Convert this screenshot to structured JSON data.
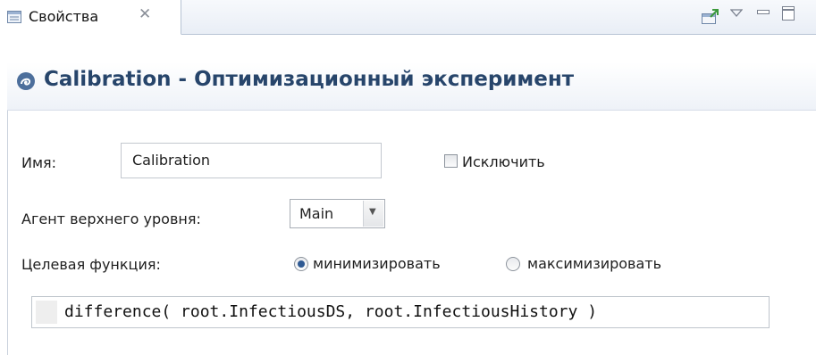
{
  "tab": {
    "label": "Свойства"
  },
  "title": {
    "text": "Calibration - Оптимизационный эксперимент"
  },
  "form": {
    "name_label": "Имя:",
    "name_value": "Calibration",
    "exclude_label": "Исключить",
    "exclude_checked": false,
    "top_agent_label": "Агент верхнего уровня:",
    "top_agent_value": "Main",
    "objective_label": "Целевая функция:",
    "minimize_label": "минимизировать",
    "maximize_label": "максимизировать",
    "selected_objective": "минимизировать",
    "objective_expression": "difference( root.InfectiousDS, root.InfectiousHistory )"
  },
  "icons": {
    "tab_icon": "properties-icon",
    "close_icon": "close-icon",
    "pin_icon": "pin-editor-icon",
    "view_menu_icon": "chevron-down-icon",
    "minimize_icon": "minimize-icon",
    "maximize_icon": "maximize-icon",
    "experiment_icon": "optimization-experiment-icon"
  },
  "colors": {
    "title_text": "#27456b",
    "radio_selected": "#2f5a93",
    "tab_border": "#b7c3d4"
  }
}
